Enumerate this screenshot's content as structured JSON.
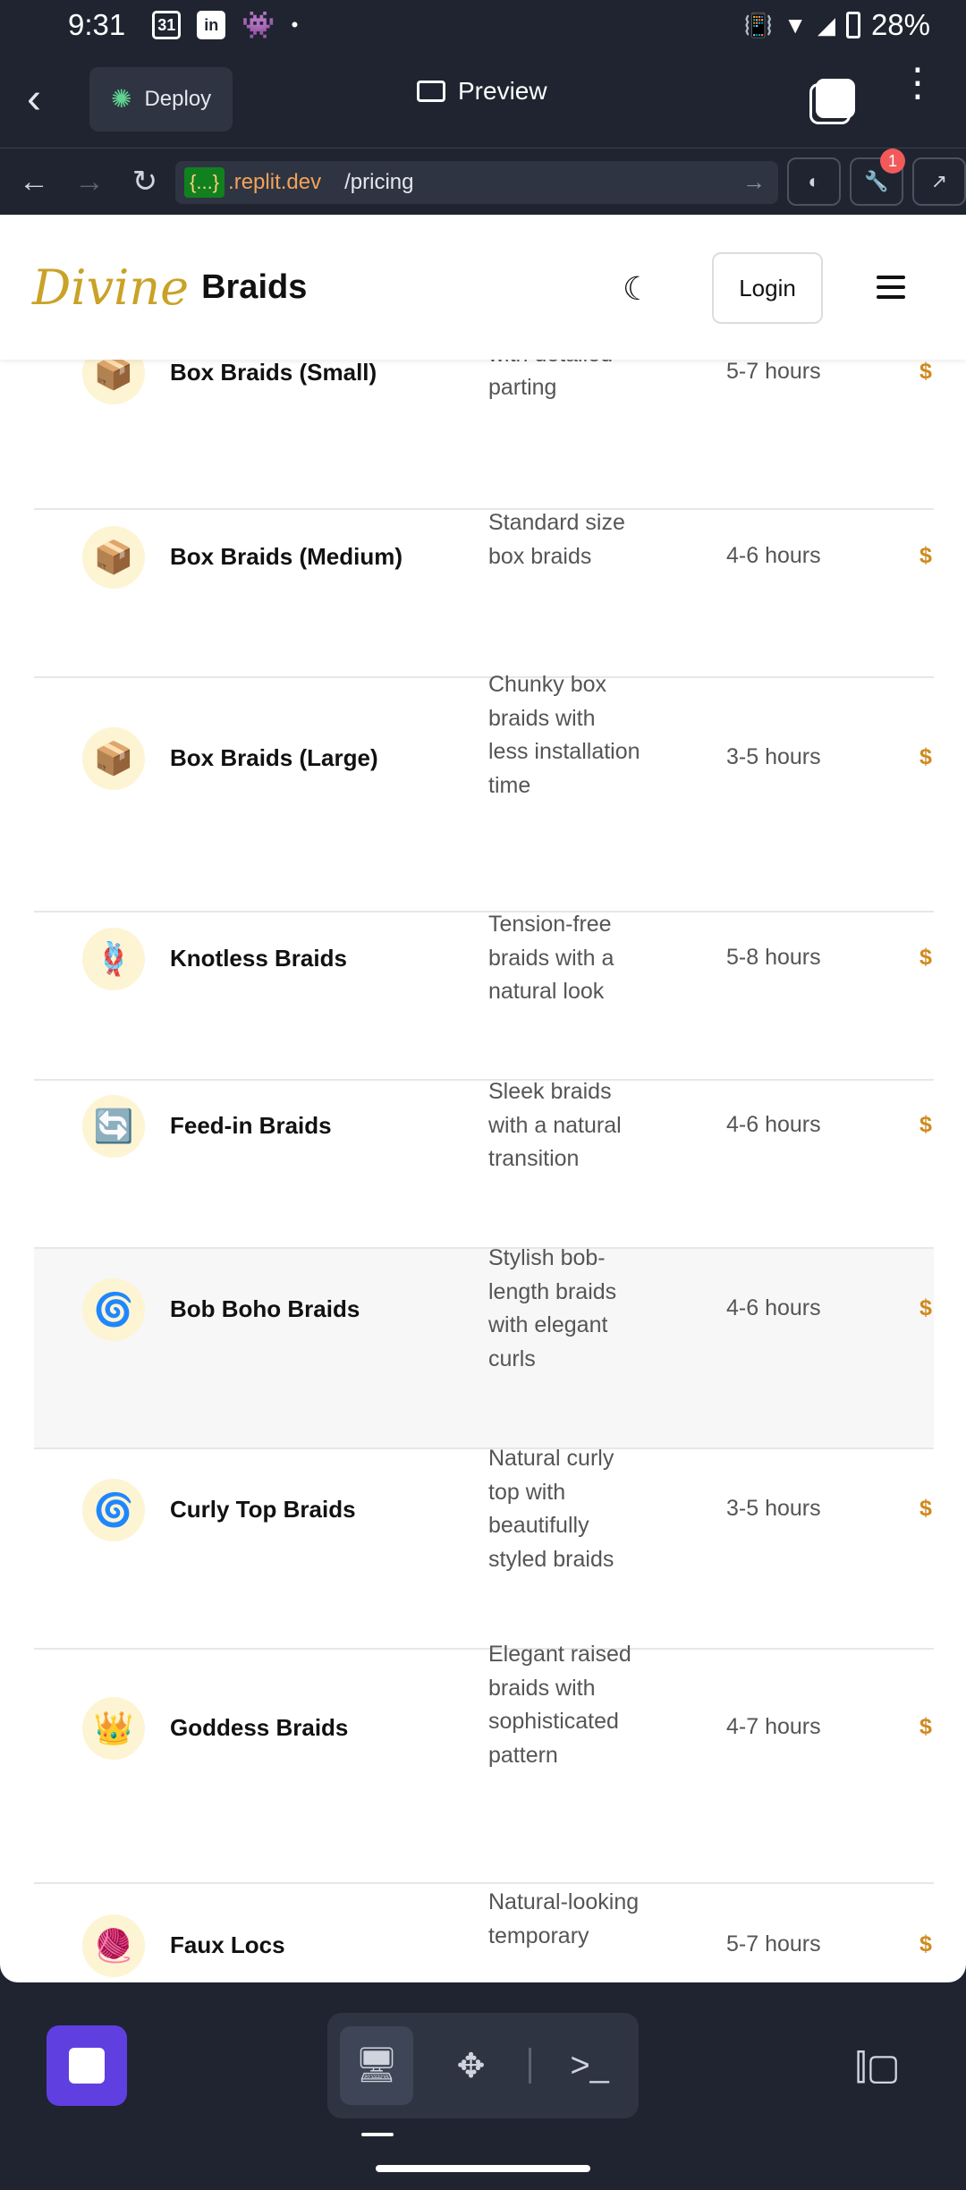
{
  "status_bar": {
    "time": "9:31",
    "left_icons": [
      "calendar-icon",
      "linkedin-icon",
      "reddit-icon",
      "dot-icon"
    ],
    "calendar_label": "31",
    "linkedin_label": "in",
    "battery": "28%"
  },
  "app_bar": {
    "deploy_label": "Deploy",
    "preview_label": "Preview"
  },
  "browser": {
    "host_tag": "{...}",
    "host": ".replit.dev",
    "path": "/pricing",
    "badge_count": "1"
  },
  "site": {
    "logo_script": "Divine",
    "logo_text": "Braids",
    "login_label": "Login"
  },
  "styles": [
    {
      "icon": "📦",
      "name": "Box Braids (Small)",
      "desc": "Thinner braids with detailed parting",
      "duration": "5-7 hours",
      "price": "$"
    },
    {
      "icon": "📦",
      "name": "Box Braids (Medium)",
      "desc": "Standard size box braids",
      "duration": "4-6 hours",
      "price": "$"
    },
    {
      "icon": "📦",
      "name": "Box Braids (Large)",
      "desc": "Chunky box braids with less installation time",
      "duration": "3-5 hours",
      "price": "$"
    },
    {
      "icon": "🪢",
      "name": "Knotless Braids",
      "desc": "Tension-free braids with a natural look",
      "duration": "5-8 hours",
      "price": "$"
    },
    {
      "icon": "🔄",
      "name": "Feed-in Braids",
      "desc": "Sleek braids with a natural transition",
      "duration": "4-6 hours",
      "price": "$"
    },
    {
      "icon": "🌀",
      "name": "Bob Boho Braids",
      "desc": "Stylish bob-length braids with elegant curls",
      "duration": "4-6 hours",
      "price": "$"
    },
    {
      "icon": "🌀",
      "name": "Curly Top Braids",
      "desc": "Natural curly top with beautifully styled braids",
      "duration": "3-5 hours",
      "price": "$"
    },
    {
      "icon": "👑",
      "name": "Goddess Braids",
      "desc": "Elegant raised braids with sophisticated pattern",
      "duration": "4-7 hours",
      "price": "$"
    },
    {
      "icon": "🧶",
      "name": "Faux Locs",
      "desc": "Natural-looking temporary",
      "duration": "5-7 hours",
      "price": "$"
    }
  ],
  "colors": {
    "accent": "#c9a227",
    "price": "#d08a1e",
    "replit_stop": "#5f3fe0"
  }
}
